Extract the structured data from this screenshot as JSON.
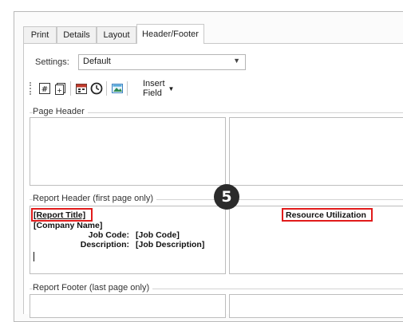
{
  "tabs": [
    {
      "label": "Print"
    },
    {
      "label": "Details"
    },
    {
      "label": "Layout"
    },
    {
      "label": "Header/Footer",
      "active": true
    }
  ],
  "settings": {
    "label": "Settings:",
    "value": "Default"
  },
  "toolbar": {
    "icons": [
      "page-number-icon",
      "total-pages-icon",
      "date-icon",
      "time-icon",
      "image-icon"
    ],
    "insert_field": "Insert Field"
  },
  "sections": {
    "page_header": "Page Header",
    "report_header": "Report Header (first page only)",
    "report_footer": "Report Footer (last page only)"
  },
  "report_header_left": {
    "report_title": "[Report Title]",
    "company_name": "[Company Name]",
    "job_code_label": "Job Code:",
    "job_code_value": "[Job Code]",
    "description_label": "Description:",
    "description_value": "[Job Description]"
  },
  "report_header_right": {
    "title": "Resource Utilization"
  },
  "annotation": {
    "step": "5"
  },
  "colors": {
    "highlight": "#e11b1b",
    "badge": "#2b2b2b"
  }
}
